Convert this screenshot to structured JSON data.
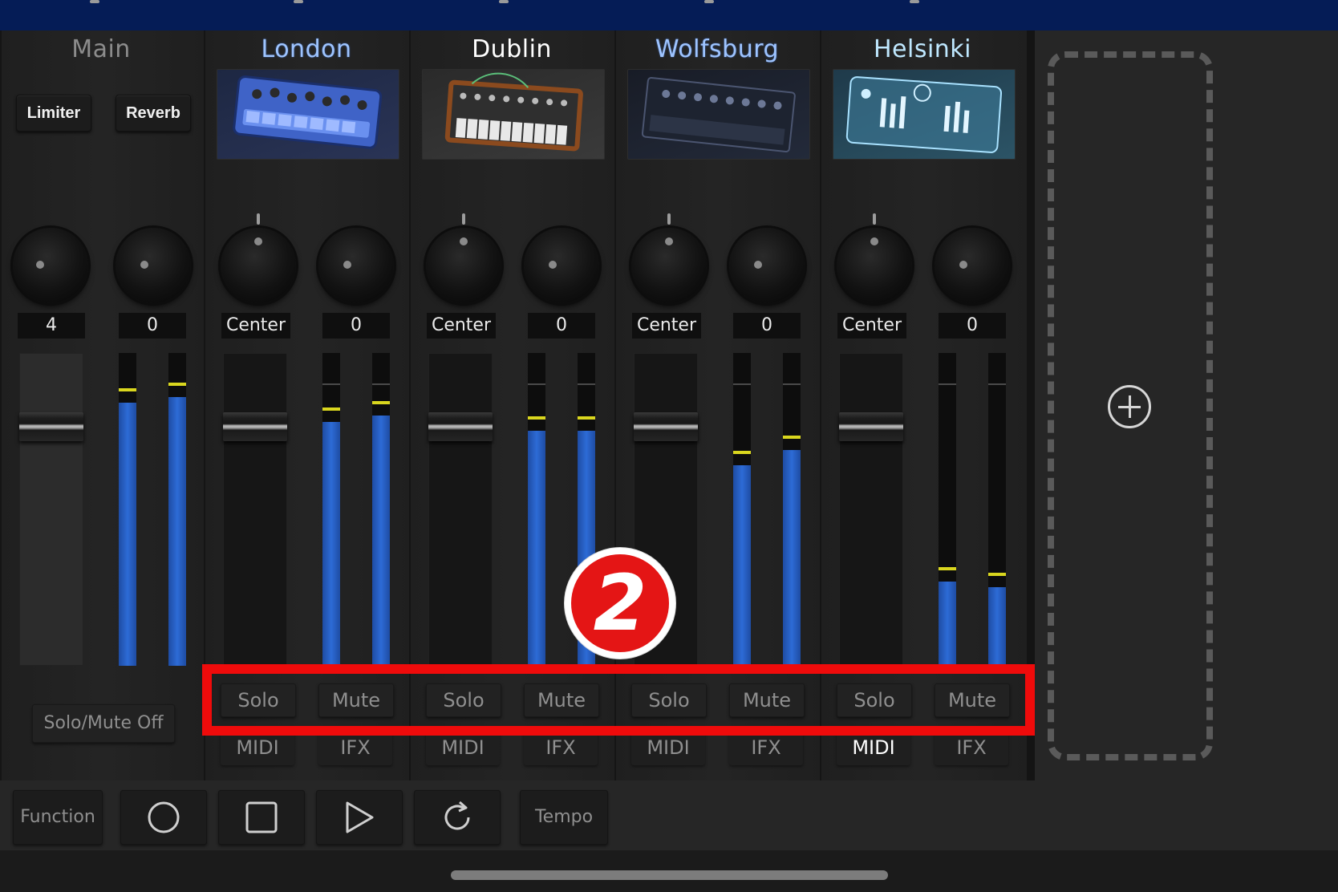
{
  "colors": {
    "accent_red": "#ef0b0b",
    "meter_blue": "#2d6bd6",
    "meter_peak": "#d9d61e",
    "topbar": "#051c56"
  },
  "main": {
    "title": "Main",
    "limiter_label": "Limiter",
    "reverb_label": "Reverb",
    "knob1_value": "4",
    "knob2_value": "0",
    "solo_mute_off_label": "Solo/Mute Off",
    "volume_level": 0.19,
    "meters": [
      0.84,
      0.86
    ]
  },
  "channels": [
    {
      "name": "London",
      "pan_value": "Center",
      "fx_value": "0",
      "solo": "Solo",
      "mute": "Mute",
      "midi": "MIDI",
      "ifx": "IFX",
      "volume_level": 0.19,
      "meters": [
        0.78,
        0.8
      ]
    },
    {
      "name": "Dublin",
      "pan_value": "Center",
      "fx_value": "0",
      "solo": "Solo",
      "mute": "Mute",
      "midi": "MIDI",
      "ifx": "IFX",
      "volume_level": 0.19,
      "meters": [
        0.75,
        0.75
      ]
    },
    {
      "name": "Wolfsburg",
      "pan_value": "Center",
      "fx_value": "0",
      "solo": "Solo",
      "mute": "Mute",
      "midi": "MIDI",
      "ifx": "IFX",
      "volume_level": 0.19,
      "meters": [
        0.64,
        0.69
      ]
    },
    {
      "name": "Helsinki",
      "pan_value": "Center",
      "fx_value": "0",
      "solo": "Solo",
      "mute": "Mute",
      "midi": "MIDI",
      "ifx": "IFX",
      "volume_level": 0.19,
      "meters": [
        0.27,
        0.25
      ]
    }
  ],
  "annotation": {
    "step_number": "2"
  },
  "add_instrument": {
    "icon": "plus-circle-icon"
  },
  "toolbar": {
    "function_label": "Function",
    "record_icon": "record-icon",
    "stop_icon": "stop-icon",
    "play_icon": "play-icon",
    "loop_icon": "loop-icon",
    "tempo_label": "Tempo"
  }
}
